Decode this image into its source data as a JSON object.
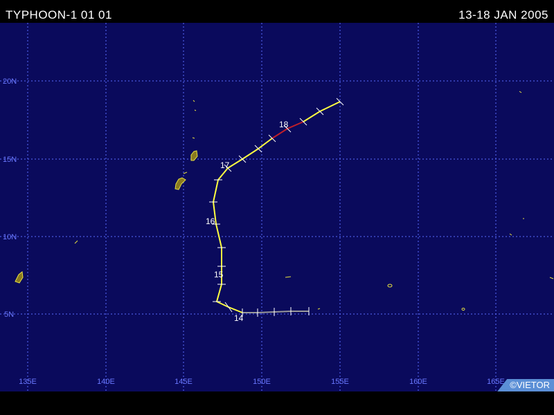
{
  "header": {
    "title": "TYPHOON-1 01 01",
    "dates": "13-18 JAN 2005"
  },
  "map": {
    "lat_labels": [
      "20N",
      "15N",
      "10N",
      "5N"
    ],
    "lon_labels": [
      "135E",
      "140E",
      "145E",
      "150E",
      "155E",
      "160E",
      "165E"
    ],
    "track_day_labels": [
      "14",
      "15",
      "16",
      "17",
      "18"
    ],
    "colors": {
      "ocean": "#0a0a5c",
      "grid": "#5b6cff",
      "grid_label": "#6a78ff",
      "land": "#8a7a20",
      "coast": "#e6e040",
      "track_main": "#ffff40",
      "track_weak": "#9a9a9a",
      "track_storm": "#c0202a"
    }
  },
  "credit": "©VIETOR"
}
